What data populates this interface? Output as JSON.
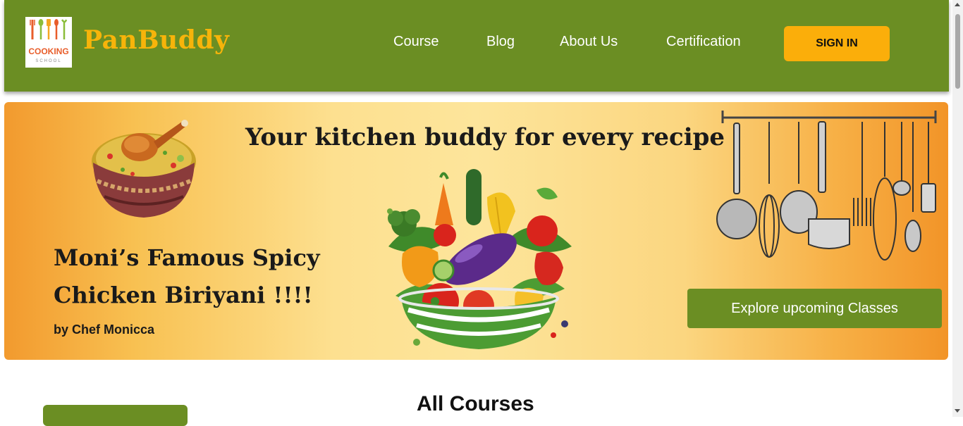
{
  "navbar": {
    "brand": "PanBuddy",
    "logo": {
      "text_top": "COOKING",
      "text_bottom": "SCHOOL",
      "icon": "cooking-school-logo"
    },
    "links": [
      "Course",
      "Blog",
      "About Us",
      "Certification"
    ],
    "signin_label": "SIGN IN"
  },
  "hero": {
    "tagline": "Your kitchen buddy for every recipe",
    "dish_line1": "Moni’s Famous Spicy",
    "dish_line2": "Chicken Biriyani !!!!",
    "chef": "by Chef Monicca",
    "explore_label": "Explore upcoming Classes",
    "images": [
      "biryani-bowl-image",
      "vegetable-bowl-image",
      "hanging-utensils-image"
    ]
  },
  "main": {
    "heading": "All Courses"
  },
  "colors": {
    "nav_green": "#6b8e23",
    "brand_yellow": "#f7b40a",
    "signin_yellow": "#fbae0a"
  }
}
